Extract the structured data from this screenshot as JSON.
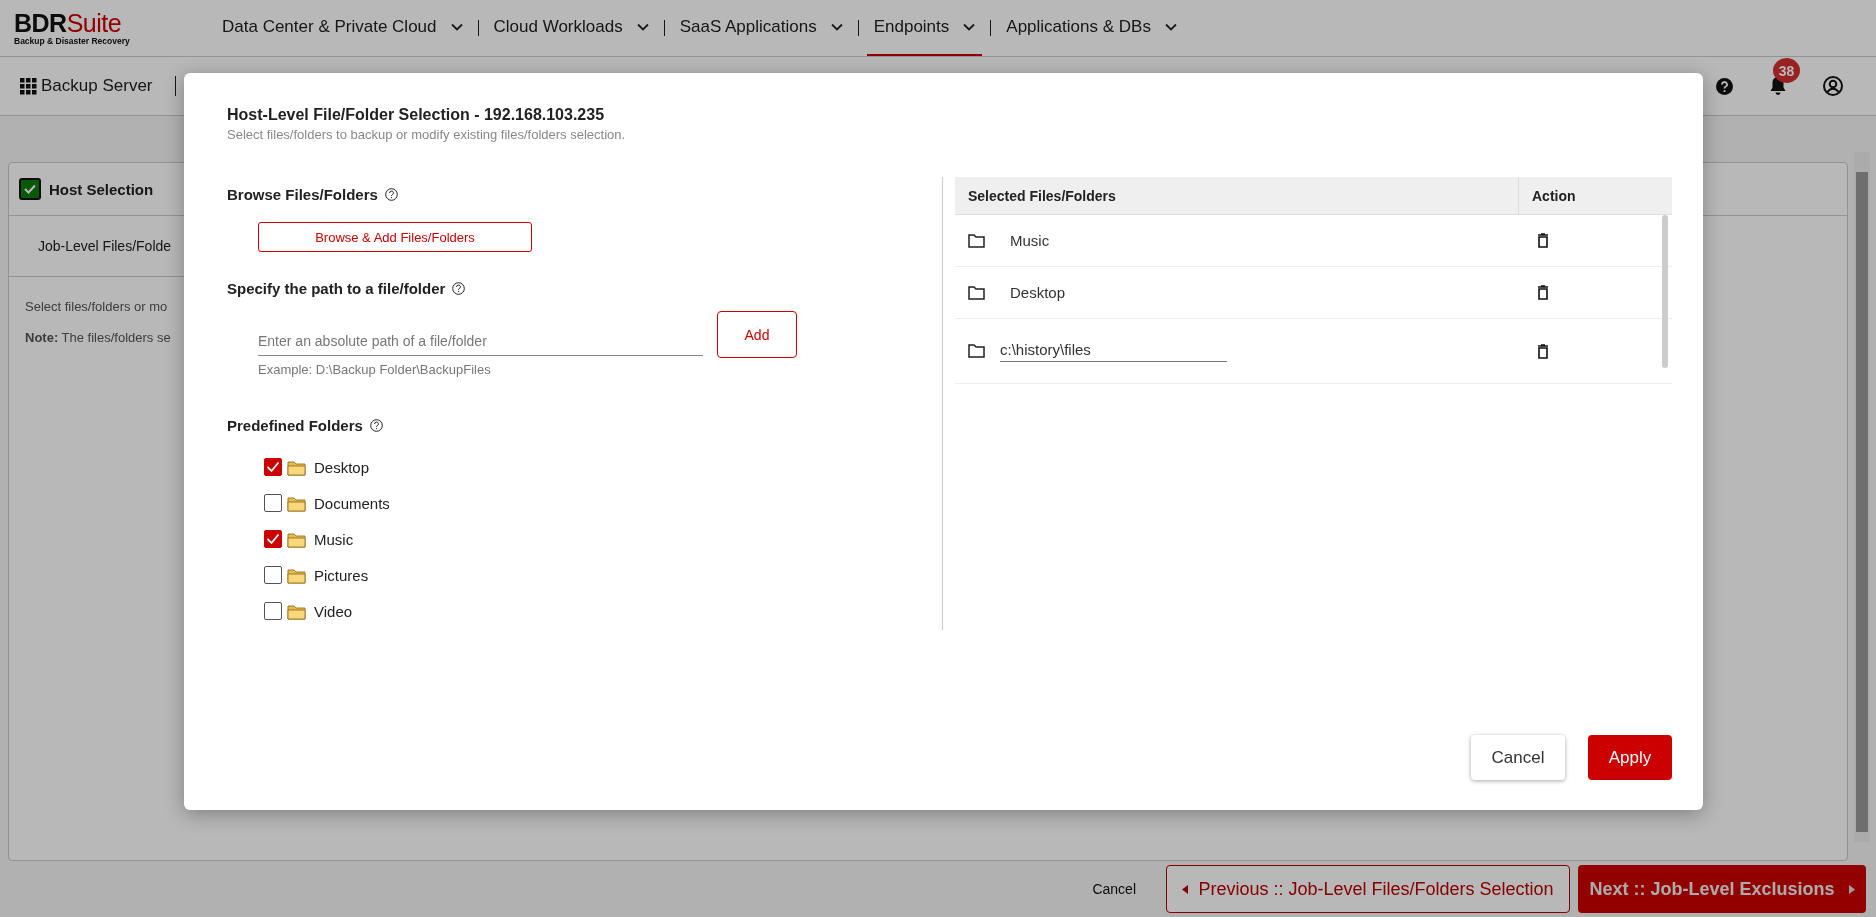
{
  "header": {
    "logo": {
      "brand": "BDR",
      "brand_accent": "Suite",
      "tagline": "Backup & Disaster Recovery"
    },
    "nav": [
      {
        "label": "Data Center & Private Cloud",
        "selected": false
      },
      {
        "label": "Cloud Workloads",
        "selected": false
      },
      {
        "label": "SaaS Applications",
        "selected": false
      },
      {
        "label": "Endpoints",
        "selected": true
      },
      {
        "label": "Applications & DBs",
        "selected": false
      }
    ],
    "notifications": "38"
  },
  "toolbar": {
    "title": "Backup Server"
  },
  "background_panel": {
    "step_title": "Host Selection",
    "step_done": true,
    "subtab": "Job-Level Files/Folde",
    "lines": [
      "Select files/folders or mo",
      "**Note:** The files/folders se"
    ]
  },
  "dialog": {
    "title": "Host-Level File/Folder Selection - 192.168.103.235",
    "subtitle": "Select files/folders to backup or modify existing files/folders selection.",
    "browse": {
      "heading": "Browse Files/Folders",
      "button": "Browse & Add Files/Folders"
    },
    "path": {
      "heading": "Specify the path to a file/folder",
      "placeholder": "Enter an absolute path of a file/folder",
      "hint": "Example: D:\\Backup Folder\\BackupFiles",
      "button": "Add"
    },
    "predefined": {
      "heading": "Predefined Folders",
      "folders": [
        {
          "label": "Desktop",
          "checked": true
        },
        {
          "label": "Documents",
          "checked": false
        },
        {
          "label": "Music",
          "checked": true
        },
        {
          "label": "Pictures",
          "checked": false
        },
        {
          "label": "Video",
          "checked": false
        }
      ]
    },
    "table": {
      "columns": [
        "Selected Files/Folders",
        "Action"
      ],
      "rows": [
        {
          "kind": "text",
          "name": "Music"
        },
        {
          "kind": "text",
          "name": "Desktop"
        },
        {
          "kind": "edit",
          "name": "c:\\history\\files"
        }
      ]
    },
    "cancel": "Cancel",
    "apply": "Apply"
  },
  "footer": {
    "cancel": "Cancel",
    "previous": "Previous :: Job-Level Files/Folders Selection",
    "next": "Next :: Job-Level Exclusions"
  }
}
